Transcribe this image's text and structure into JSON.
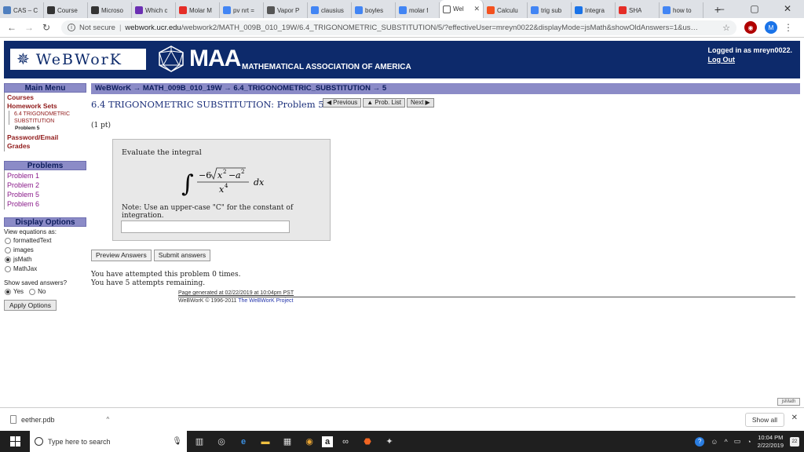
{
  "browser": {
    "tabs": [
      {
        "label": "CAS – C",
        "color": "#4f7fbf"
      },
      {
        "label": "Course",
        "color": "#333333"
      },
      {
        "label": "Microso",
        "color": "#333333"
      },
      {
        "label": "Which c",
        "color": "#6b2fb3"
      },
      {
        "label": "Molar M",
        "color": "#e52d27"
      },
      {
        "label": "pv nrt =",
        "color": "#4285f4"
      },
      {
        "label": "Vapor P",
        "color": "#555555"
      },
      {
        "label": "clausius",
        "color": "#4285f4"
      },
      {
        "label": "boyles",
        "color": "#4285f4"
      },
      {
        "label": "molar f",
        "color": "#4285f4"
      },
      {
        "label": "Wel",
        "color": "#ffffff",
        "active": true
      },
      {
        "label": "Calculu",
        "color": "#f4511e"
      },
      {
        "label": "trig sub",
        "color": "#4285f4"
      },
      {
        "label": "Integra",
        "color": "#1a73e8"
      },
      {
        "label": "SHA",
        "color": "#e52d27"
      },
      {
        "label": "how to",
        "color": "#4285f4"
      }
    ],
    "security": "Not secure",
    "host": "webwork.ucr.edu",
    "path": "/webwork2/MATH_009B_010_19W/6.4_TRIGONOMETRIC_SUBSTITUTION/5/?effectiveUser=mreyn0022&displayMode=jsMath&showOldAnswers=1&user=mreyn0022&k...",
    "profile_initial": "M"
  },
  "header": {
    "logo_text": "WeBWorK",
    "maa_short": "MAA",
    "maa_full": "MATHEMATICAL ASSOCIATION OF AMERICA",
    "logged_in": "Logged in as mreyn0022.",
    "logout": "Log Out"
  },
  "sidebar": {
    "main_menu": "Main Menu",
    "links": {
      "courses": "Courses",
      "homework_sets": "Homework Sets",
      "set_name": "6.4 TRIGONOMETRIC SUBSTITUTION",
      "problem": "Problem 5",
      "password": "Password/Email",
      "grades": "Grades"
    },
    "problems_head": "Problems",
    "problems": [
      "Problem 1",
      "Problem 2",
      "Problem 5",
      "Problem 6"
    ],
    "display_head": "Display Options",
    "view_eq": "View equations as:",
    "modes": [
      {
        "label": "formattedText",
        "checked": false
      },
      {
        "label": "images",
        "checked": false
      },
      {
        "label": "jsMath",
        "checked": true
      },
      {
        "label": "MathJax",
        "checked": false
      }
    ],
    "show_saved": "Show saved answers?",
    "yes": "Yes",
    "no": "No",
    "apply": "Apply Options"
  },
  "main": {
    "breadcrumb": "WeBWorK → MATH_009B_010_19W → 6.4_TRIGONOMETRIC_SUBSTITUTION → 5",
    "title": "6.4 TRIGONOMETRIC SUBSTITUTION: Problem 5",
    "nav": {
      "previous": "Previous",
      "problist": "Prob. List",
      "next": "Next"
    },
    "points": "(1 pt)",
    "intro": "Evaluate the integral",
    "integrand": {
      "coef": "−6",
      "radicand_x": "x",
      "radicand_a": "a",
      "power_num": "2",
      "power_den": "4",
      "var": "x",
      "dx": "dx"
    },
    "note": "Note: Use an upper-case \"C\" for the constant of integration.",
    "answer_value": "",
    "preview": "Preview Answers",
    "submit": "Submit answers",
    "attempted": "You have attempted this problem 0 times.",
    "remaining": "You have 5 attempts remaining.",
    "generated": "Page generated at 02/22/2019 at 10:04pm PST",
    "copyright": "WeBWorK © 1996-2011",
    "project": "The WeBWorK Project",
    "jsmath_badge": "jsMath"
  },
  "downloads": {
    "file": "eether.pdb",
    "show_all": "Show all"
  },
  "taskbar": {
    "search": "Type here to search",
    "time": "10:04 PM",
    "date": "2/22/2019",
    "notifications": "22"
  }
}
